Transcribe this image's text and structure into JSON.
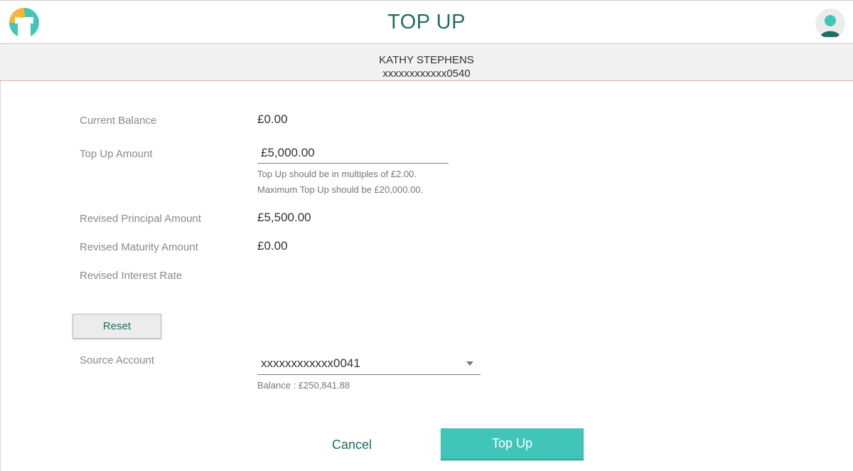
{
  "header": {
    "title": "TOP UP",
    "logo_icon": "app-logo-icon",
    "avatar_icon": "user-avatar-icon"
  },
  "customer": {
    "name": "KATHY STEPHENS",
    "account": "xxxxxxxxxxxx0540"
  },
  "form": {
    "current_balance_label": "Current Balance",
    "current_balance_value": "£0.00",
    "topup_amount_label": "Top Up Amount",
    "topup_amount_value": "£5,000.00",
    "hint_multiples": "Top Up should be in multiples of £2.00.",
    "hint_maximum": "Maximum Top Up should be £20,000.00.",
    "revised_principal_label": "Revised Principal Amount",
    "revised_principal_value": "£5,500.00",
    "revised_maturity_label": "Revised Maturity Amount",
    "revised_maturity_value": "£0.00",
    "revised_interest_label": "Revised Interest Rate",
    "reset_label": "Reset",
    "source_account_label": "Source Account",
    "source_account_value": "xxxxxxxxxxxx0041",
    "source_account_balance": "Balance : £250,841.88"
  },
  "actions": {
    "cancel_label": "Cancel",
    "topup_label": "Top Up"
  },
  "colors": {
    "brand_dark": "#1f6e62",
    "brand_accent": "#41c5b8",
    "logo_yellow": "#f5b731"
  }
}
